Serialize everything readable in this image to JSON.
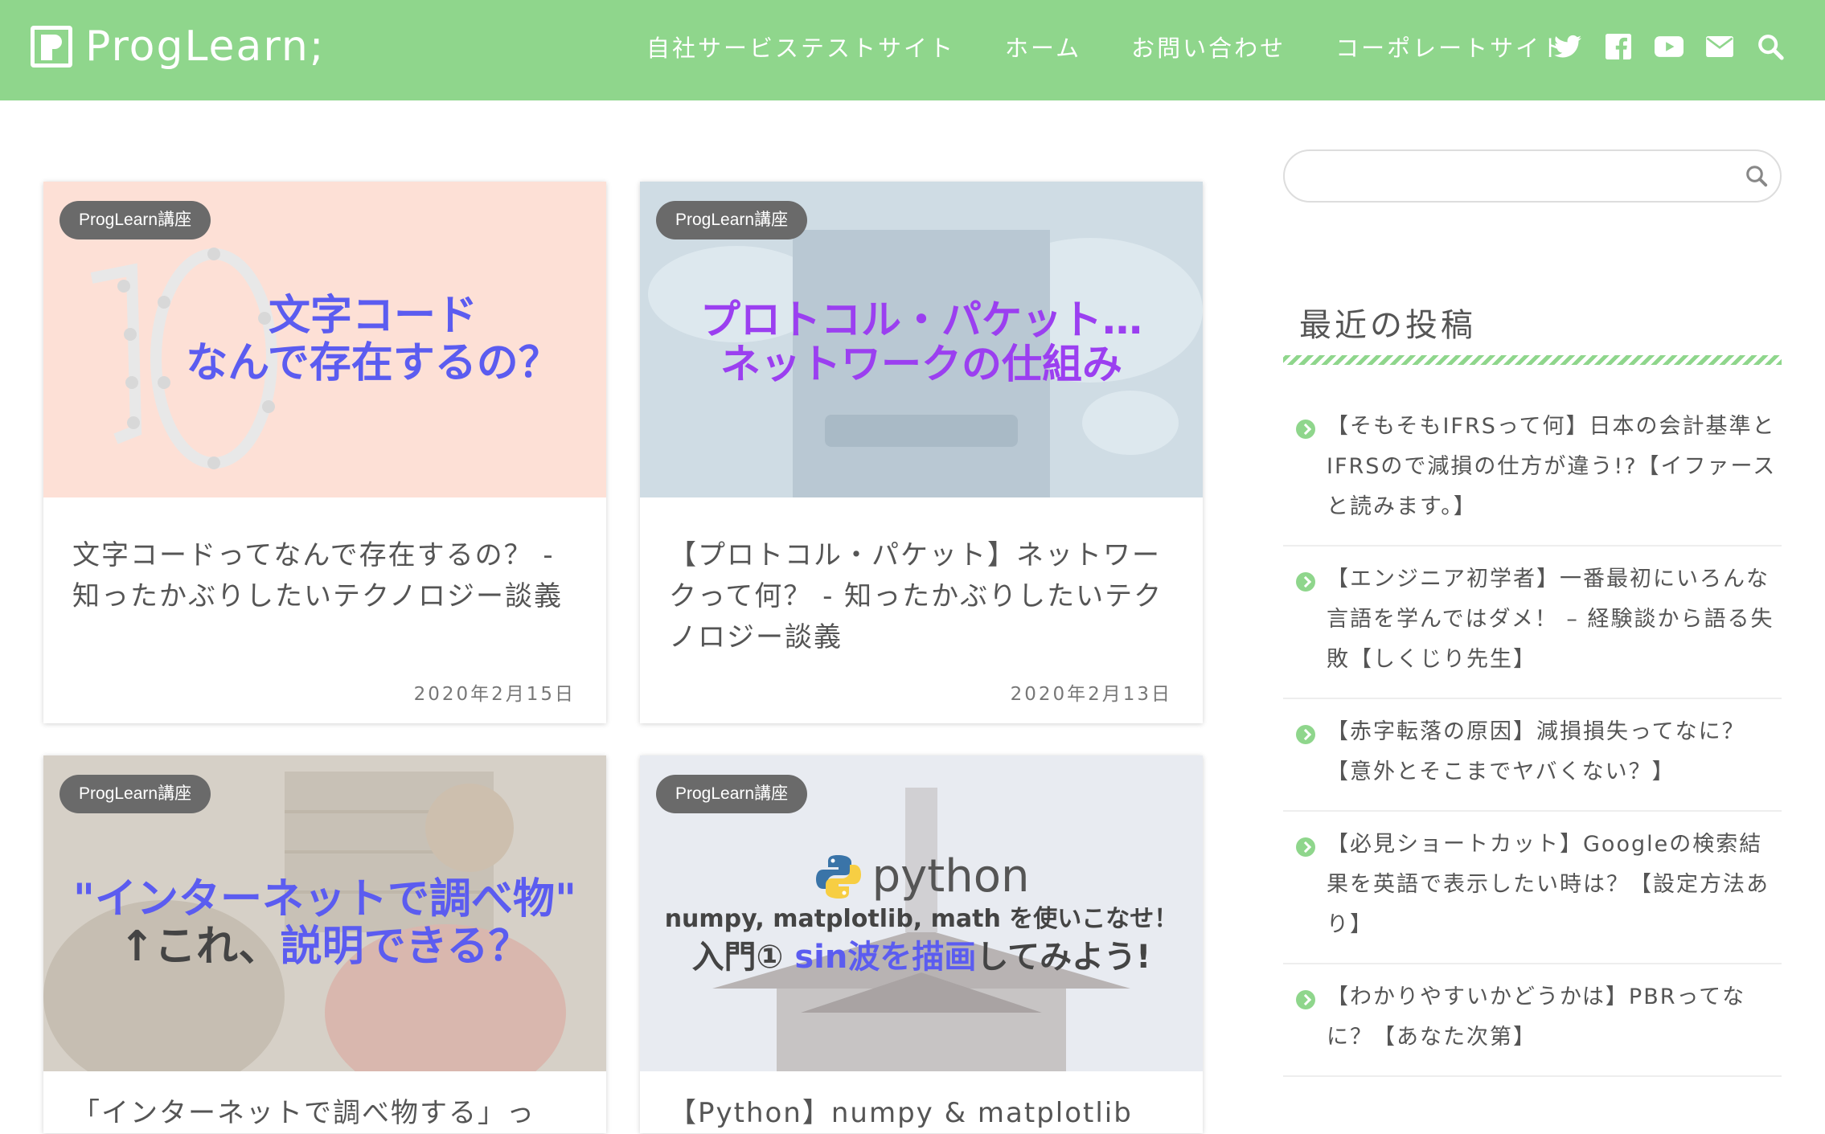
{
  "header": {
    "logo": "ProgLearn;",
    "nav": [
      {
        "label": "自社サービステストサイト"
      },
      {
        "label": "ホーム"
      },
      {
        "label": "お問い合わせ"
      },
      {
        "label": "コーポレートサイト"
      }
    ],
    "icons": [
      "twitter-icon",
      "facebook-icon",
      "youtube-icon",
      "mail-icon",
      "search-icon"
    ],
    "colors": {
      "header_bg": "#8fd68c",
      "accent": "#8fd68c"
    }
  },
  "cards": [
    {
      "badge": "ProgLearn講座",
      "thumb_text_line1": "文字コード",
      "thumb_text_line2": "なんで存在するの？",
      "title": "文字コードってなんで存在するの？ - 知ったかぶりしたいテクノロジー談義",
      "date": "2020年2月15日"
    },
    {
      "badge": "ProgLearn講座",
      "thumb_text_line1": "プロトコル・パケット…",
      "thumb_text_line2": "ネットワークの仕組み",
      "title": "【プロトコル・パケット】ネットワークって何？ - 知ったかぶりしたいテクノロジー談義",
      "date": "2020年2月13日"
    },
    {
      "badge": "ProgLearn講座",
      "thumb_text_line1": "\"インターネットで調べ物\"",
      "thumb_text_line2_a": "↑これ、",
      "thumb_text_line2_b": "説明できる？",
      "title": "「インターネットで調べ物する」っ"
    },
    {
      "badge": "ProgLearn講座",
      "thumb_logo": "python",
      "thumb_text_line1": "numpy, matplotlib, math を使いこなせ！",
      "thumb_text_line2_a": "入門①",
      "thumb_text_line2_b": "sin波を描画",
      "thumb_text_line2_c": "してみよう!",
      "title": "【Python】numpy & matplotlib"
    }
  ],
  "sidebar": {
    "search_placeholder": "",
    "heading": "最近の投稿",
    "posts": [
      "【そもそもIFRSって何】日本の会計基準とIFRSので減損の仕方が違う!?【イファースと読みます。】",
      "【エンジニア初学者】一番最初にいろんな言語を学んではダメ！ – 経験談から語る失敗【しくじり先生】",
      "【赤字転落の原因】減損損失ってなに？【意外とそこまでヤバくない？】",
      "【必見ショートカット】Googleの検索結果を英語で表示したい時は？【設定方法あり】",
      "【わかりやすいかどうかは】PBRってなに？【あなた次第】"
    ]
  }
}
